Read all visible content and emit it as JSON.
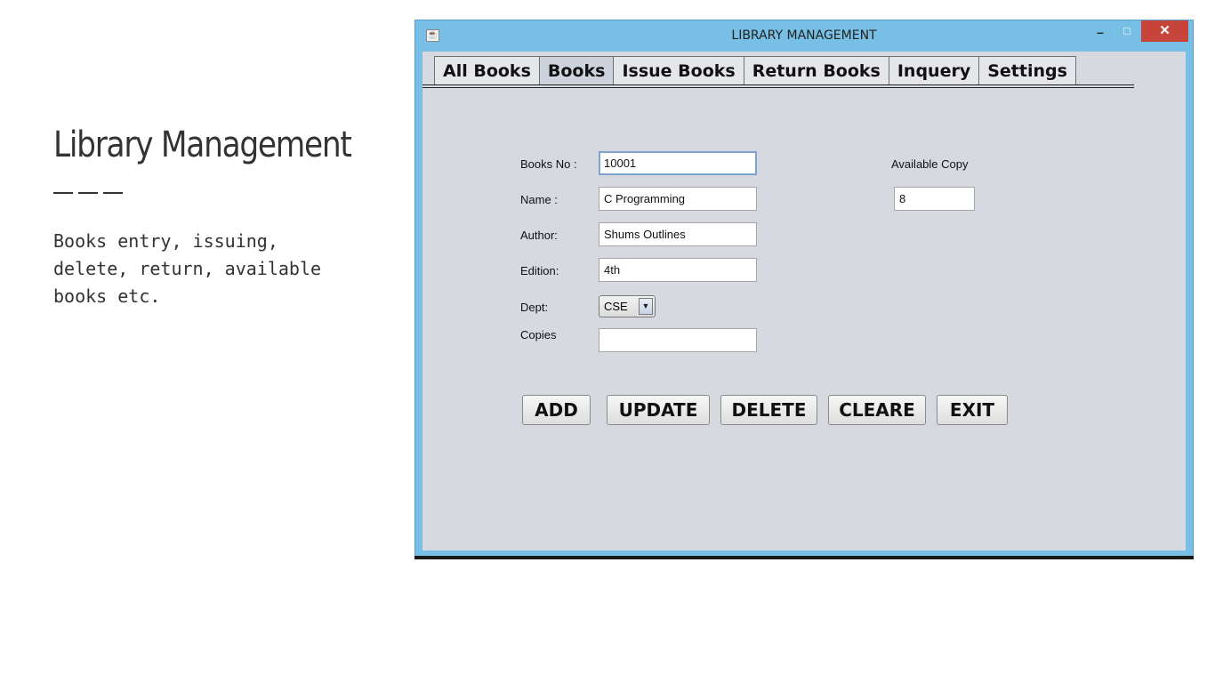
{
  "slide": {
    "title": "Library Management",
    "description": "Books entry, issuing,\ndelete, return, available\nbooks etc."
  },
  "window": {
    "title": "LIBRARY MANAGEMENT",
    "minimize": "–",
    "maximize": "□",
    "close": "✕"
  },
  "tabs": [
    "All Books",
    "Books",
    "Issue Books",
    "Return Books",
    "Inquery",
    "Settings"
  ],
  "active_tab": "Books",
  "form": {
    "books_no_label": "Books No :",
    "books_no": "10001",
    "name_label": "Name :",
    "name": "C Programming",
    "author_label": "Author:",
    "author": "Shums Outlines",
    "edition_label": "Edition:",
    "edition": "4th",
    "dept_label": "Dept:",
    "dept": "CSE",
    "copies_label": "Copies",
    "copies": "",
    "available_label": "Available Copy",
    "available": "8"
  },
  "buttons": {
    "add": "ADD",
    "update": "UPDATE",
    "delete": "DELETE",
    "clear": "CLEARE",
    "exit": "EXIT"
  }
}
